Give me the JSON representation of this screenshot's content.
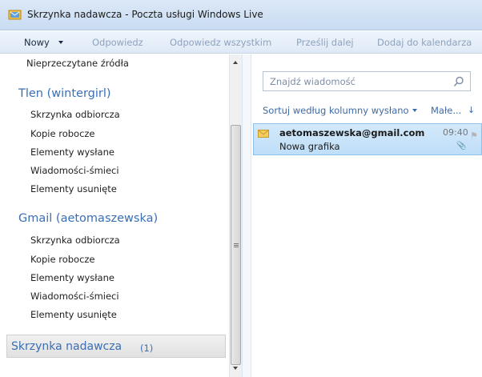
{
  "window": {
    "title": "Skrzynka nadawcza - Poczta usługi Windows Live"
  },
  "toolbar": {
    "new_label": "Nowy",
    "reply_label": "Odpowiedz",
    "reply_all_label": "Odpowiedz wszystkim",
    "forward_label": "Prześlij dalej",
    "calendar_label": "Dodaj do kalendarza"
  },
  "folders": {
    "unread_feeds": "Nieprzeczytane źródła",
    "accounts": [
      {
        "name": "Tlen (wintergirl)",
        "items": [
          "Skrzynka odbiorcza",
          "Kopie robocze",
          "Elementy wysłane",
          "Wiadomości-śmieci",
          "Elementy usunięte"
        ]
      },
      {
        "name": "Gmail (aetomaszewska)",
        "items": [
          "Skrzynka odbiorcza",
          "Kopie robocze",
          "Elementy wysłane",
          "Wiadomości-śmieci",
          "Elementy usunięte"
        ]
      }
    ],
    "outbox": {
      "label": "Skrzynka nadawcza",
      "count": "(1)"
    }
  },
  "message_list": {
    "search_placeholder": "Znajdź wiadomość",
    "sort_label": "Sortuj według kolumny wysłano",
    "size_label": "Małe...",
    "messages": [
      {
        "sender": "aetomaszewska@gmail.com",
        "subject": "Nowa grafika",
        "time": "09:40"
      }
    ]
  },
  "colors": {
    "accent": "#3a6fb5",
    "selection": "#cde6fa"
  }
}
